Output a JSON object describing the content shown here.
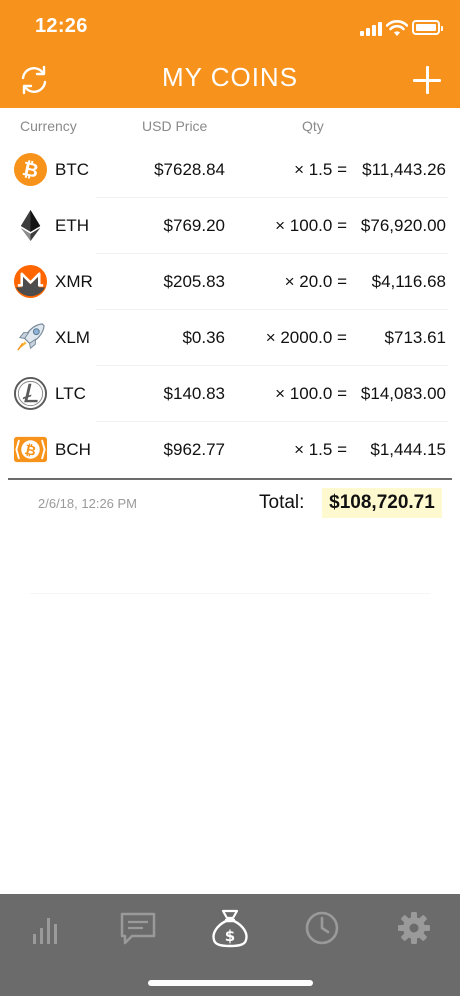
{
  "status_bar": {
    "time": "12:26"
  },
  "nav": {
    "title": "MY COINS",
    "refresh_icon": "refresh-icon",
    "add_icon": "plus-icon"
  },
  "columns": {
    "currency": "Currency",
    "price": "USD Price",
    "qty": "Qty"
  },
  "coins": [
    {
      "symbol": "BTC",
      "price": "$7628.84",
      "qty": "× 1.5 =",
      "value": "$11,443.26",
      "icon": "bitcoin-icon",
      "color": "#f7931a"
    },
    {
      "symbol": "ETH",
      "price": "$769.20",
      "qty": "× 100.0 =",
      "value": "$76,920.00",
      "icon": "ethereum-icon",
      "color": "#3c3c3d"
    },
    {
      "symbol": "XMR",
      "price": "$205.83",
      "qty": "× 20.0 =",
      "value": "$4,116.68",
      "icon": "monero-icon",
      "color": "#ff6600"
    },
    {
      "symbol": "XLM",
      "price": "$0.36",
      "qty": "× 2000.0 =",
      "value": "$713.61",
      "icon": "stellar-rocket-icon",
      "color": "#8fb4d6"
    },
    {
      "symbol": "LTC",
      "price": "$140.83",
      "qty": "× 100.0 =",
      "value": "$14,083.00",
      "icon": "litecoin-icon",
      "color": "#5a5a5a"
    },
    {
      "symbol": "BCH",
      "price": "$962.77",
      "qty": "× 1.5 =",
      "value": "$1,444.15",
      "icon": "bitcoin-cash-icon",
      "color": "#f7931a"
    }
  ],
  "summary": {
    "timestamp": "2/6/18, 12:26 PM",
    "total_label": "Total:",
    "total_value": "$108,720.71"
  },
  "tab_bar": {
    "tabs": [
      {
        "name": "charts",
        "icon": "bar-chart-icon",
        "active": false
      },
      {
        "name": "messages",
        "icon": "chat-icon",
        "active": false
      },
      {
        "name": "portfolio",
        "icon": "money-bag-icon",
        "active": true
      },
      {
        "name": "history",
        "icon": "clock-icon",
        "active": false
      },
      {
        "name": "settings",
        "icon": "gear-icon",
        "active": false
      }
    ]
  },
  "colors": {
    "accent": "#f7931d",
    "tab_bar": "#6b6b6b",
    "total_highlight": "#fef9cf"
  }
}
